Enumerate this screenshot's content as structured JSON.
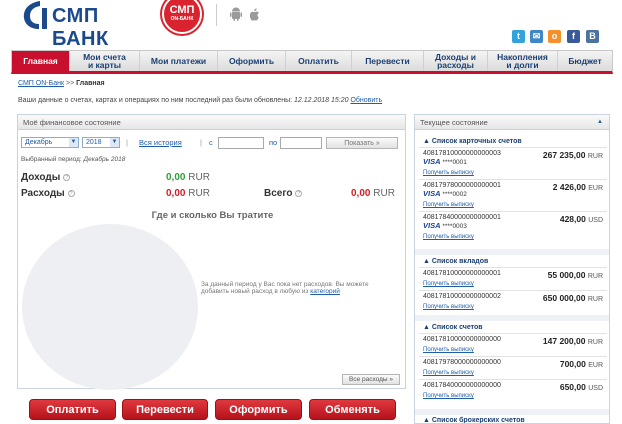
{
  "header": {
    "bank_name": "СМП БАНК",
    "seal_top": "СМП",
    "seal_bottom": "ON-БАНК",
    "icons": [
      "android-icon",
      "apple-icon"
    ],
    "social": [
      {
        "name": "twitter-icon",
        "glyph": "t",
        "color": "#33a3dd"
      },
      {
        "name": "mail-icon",
        "glyph": "✉",
        "color": "#3d87c8"
      },
      {
        "name": "odnoklassniki-icon",
        "glyph": "о",
        "color": "#f5902a"
      },
      {
        "name": "facebook-icon",
        "glyph": "f",
        "color": "#3b5a9a"
      },
      {
        "name": "vk-icon",
        "glyph": "В",
        "color": "#4b739f"
      }
    ],
    "brand_color": "#1b4a8c",
    "accent_color": "#c8102e"
  },
  "nav": {
    "items": [
      {
        "label": "Главная"
      },
      {
        "label": "Мои счета\nи карты"
      },
      {
        "label": "Мои платежи"
      },
      {
        "label": "Оформить"
      },
      {
        "label": "Оплатить"
      },
      {
        "label": "Перевести"
      },
      {
        "label": "Доходы и\nрасходы"
      },
      {
        "label": "Накопления\nи долги"
      },
      {
        "label": "Бюджет"
      }
    ]
  },
  "breadcrumb": {
    "link": "СМП ON-Банк",
    "sep": ">>",
    "current": "Главная"
  },
  "updated": {
    "text": "Ваши данные о счетах, картах и операциях по ним последний раз были обновлены:",
    "date": "12.12.2018 15:20",
    "link": "Обновить"
  },
  "finance": {
    "title": "Моё финансовое состояние",
    "month": "Декабрь",
    "year": "2018",
    "history_link": "Вся история",
    "pipe": "|",
    "from_label": "с",
    "to_label": "по",
    "show_button": "Показать  »",
    "period_label": "Выбранный период:",
    "period_value": "Декабрь 2018",
    "income_label": "Доходы",
    "income_value": "0,00",
    "expense_label": "Расходы",
    "expense_value": "0,00",
    "total_label": "Всего",
    "total_value": "0,00",
    "currency": "RUR",
    "chart_title": "Где и сколько Вы тратите",
    "nodata_text": "За данный период у Вас пока нет расходов. Вы можете добавить новый расход в любую из",
    "nodata_link": "категорий",
    "all_expenses_button": "Все расходы  »",
    "help_glyph": "?"
  },
  "actions": [
    {
      "label": "Оплатить"
    },
    {
      "label": "Перевести"
    },
    {
      "label": "Оформить"
    },
    {
      "label": "Обменять"
    }
  ],
  "current_state": {
    "title": "Текущее состояние",
    "caret": "▲",
    "get_statement": "Получить выписку",
    "card_accounts": {
      "title": "▲ Список карточных счетов",
      "items": [
        {
          "account": "40817810000000000003",
          "amount": "267 235,00",
          "currency": "RUR",
          "card_brand": "VISA",
          "card_mask": "****0001"
        },
        {
          "account": "40817978000000000001",
          "amount": "2 426,00",
          "currency": "EUR",
          "card_brand": "VISA",
          "card_mask": "****0002"
        },
        {
          "account": "40817840000000000001",
          "amount": "428,00",
          "currency": "USD",
          "card_brand": "VISA",
          "card_mask": "****0003"
        }
      ]
    },
    "deposits": {
      "title": "▲ Список вкладов",
      "items": [
        {
          "account": "40817810000000000001",
          "amount": "55 000,00",
          "currency": "RUR"
        },
        {
          "account": "40817810000000000002",
          "amount": "650 000,00",
          "currency": "RUR"
        }
      ]
    },
    "accounts": {
      "title": "▲ Список счетов",
      "items": [
        {
          "account": "40817810000000000000",
          "amount": "147 200,00",
          "currency": "RUR"
        },
        {
          "account": "40817978000000000000",
          "amount": "700,00",
          "currency": "EUR"
        },
        {
          "account": "40817840000000000000",
          "amount": "650,00",
          "currency": "USD"
        }
      ]
    },
    "brokerage": {
      "title": "▲ Список брокерских счетов"
    }
  }
}
